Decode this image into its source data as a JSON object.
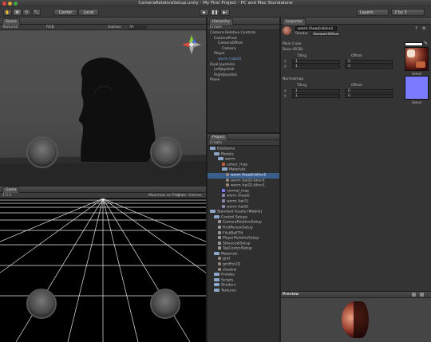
{
  "window": {
    "title": "CameraRelativeSetup.unity - My First Project - PC and Mac Standalone"
  },
  "toolbar": {
    "tools": [
      "hand",
      "move",
      "rotate",
      "scale"
    ],
    "pivot": "Center",
    "space": "Local",
    "play": "play",
    "pause": "pause",
    "step": "step",
    "layers": "Layers",
    "layout": "2 by 3"
  },
  "scene": {
    "tab": "Scene",
    "mode": "Textured",
    "render": "RGB",
    "gizmos": "Gizmos",
    "search": "All"
  },
  "game": {
    "tab": "Game",
    "aspect": "1.5:1",
    "maximize": "Maximize on Play",
    "stats": "Stats",
    "gizmos": "Gizmos"
  },
  "hierarchy": {
    "tab": "Hierarchy",
    "create": "Create",
    "items": [
      {
        "label": "Camera Relative Controls",
        "indent": 0
      },
      {
        "label": "CameraPivot",
        "indent": 1
      },
      {
        "label": "CameraOffset",
        "indent": 2
      },
      {
        "label": "Camera",
        "indent": 3
      },
      {
        "label": "Player",
        "indent": 1
      },
      {
        "label": "worm (robot)",
        "indent": 2,
        "highlight": true
      },
      {
        "label": "Dual Joysticks",
        "indent": 0
      },
      {
        "label": "LeftJoystick",
        "indent": 1
      },
      {
        "label": "RightJoystick",
        "indent": 1
      },
      {
        "label": "Plane",
        "indent": 0
      }
    ]
  },
  "project": {
    "tab": "Project",
    "create": "Create",
    "items": [
      {
        "label": "DistGame",
        "indent": 0,
        "type": "folder"
      },
      {
        "label": "Models",
        "indent": 1,
        "type": "folder"
      },
      {
        "label": "worm",
        "indent": 2,
        "type": "folder"
      },
      {
        "label": "colour_map",
        "indent": 3,
        "type": "texture"
      },
      {
        "label": "Materials",
        "indent": 3,
        "type": "folder"
      },
      {
        "label": "worm (head)-blinn1",
        "indent": 4,
        "type": "material",
        "selected": true
      },
      {
        "label": "worm (tail2)-blinn1",
        "indent": 4,
        "type": "material"
      },
      {
        "label": "worm (tail2)-blinn1",
        "indent": 4,
        "type": "material"
      },
      {
        "label": "normal_map",
        "indent": 3,
        "type": "texture"
      },
      {
        "label": "worm (head)",
        "indent": 3,
        "type": "mesh"
      },
      {
        "label": "worm (tail1)",
        "indent": 3,
        "type": "mesh"
      },
      {
        "label": "worm (tail2)",
        "indent": 3,
        "type": "mesh"
      },
      {
        "label": "Standard Assets (Mobile)",
        "indent": 0,
        "type": "folder"
      },
      {
        "label": "Control Setups",
        "indent": 1,
        "type": "folder"
      },
      {
        "label": "CameraRelativeSetup",
        "indent": 2,
        "type": "scene"
      },
      {
        "label": "FirstPersonSetup",
        "indent": 2,
        "type": "scene"
      },
      {
        "label": "FlickBallTilt",
        "indent": 2,
        "type": "scene"
      },
      {
        "label": "PlayerRelativeSetup",
        "indent": 2,
        "type": "scene"
      },
      {
        "label": "SidescrollSetup",
        "indent": 2,
        "type": "scene"
      },
      {
        "label": "TapControlSetup",
        "indent": 2,
        "type": "scene"
      },
      {
        "label": "Materials",
        "indent": 1,
        "type": "folder"
      },
      {
        "label": "grid",
        "indent": 2,
        "type": "material"
      },
      {
        "label": "gridFor2D",
        "indent": 2,
        "type": "material"
      },
      {
        "label": "shadow",
        "indent": 2,
        "type": "material"
      },
      {
        "label": "Prefabs",
        "indent": 1,
        "type": "folder"
      },
      {
        "label": "Scripts",
        "indent": 1,
        "type": "folder"
      },
      {
        "label": "Shaders",
        "indent": 1,
        "type": "folder"
      },
      {
        "label": "Textures",
        "indent": 1,
        "type": "folder"
      }
    ]
  },
  "inspector": {
    "tab": "Inspector",
    "name": "worm (head)-blinn1",
    "shader_label": "Shader",
    "shader": "Bumped Diffuse",
    "main_color": "Main Color",
    "base_label": "Base (RGB)",
    "normal_label": "Normalmap",
    "tiling": "Tiling",
    "offset": "Offset",
    "x": "x",
    "y": "y",
    "values": {
      "tx": "1",
      "ty": "1",
      "ox": "0",
      "oy": "0"
    },
    "select": "Select",
    "colors": {
      "main": "#ffffff",
      "normal": "#7b7bff",
      "base": "#8a3a2a"
    }
  },
  "preview": {
    "tab": "Preview"
  }
}
